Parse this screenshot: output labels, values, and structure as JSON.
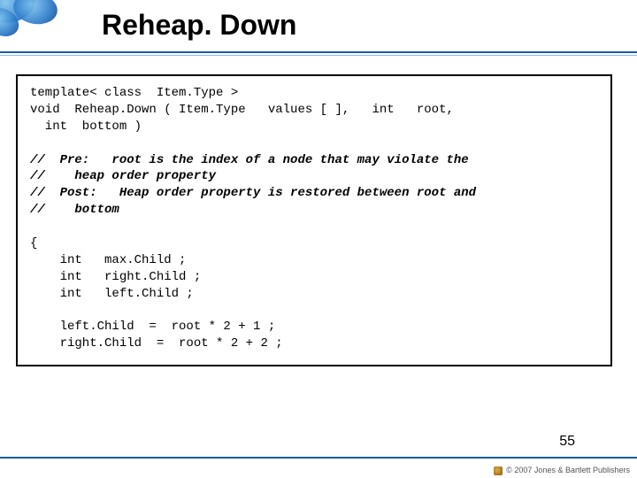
{
  "title": "Reheap. Down",
  "code": {
    "sig1": "template< class  Item.Type >",
    "sig2": "void  Reheap.Down ( Item.Type   values [ ],   int   root,",
    "sig3": "  int  bottom )",
    "cmt1": "//  Pre:   root is the index of a node that may violate the",
    "cmt2": "//    heap order property",
    "cmt3": "//  Post:   Heap order property is restored between root and",
    "cmt4": "//    bottom",
    "brace": "{",
    "decl1": "    int   max.Child ;",
    "decl2": "    int   right.Child ;",
    "decl3": "    int   left.Child ;",
    "asg1": "    left.Child  =  root * 2 + 1 ;",
    "asg2": "    right.Child  =  root * 2 + 2 ;"
  },
  "page_number": "55",
  "footer": "© 2007 Jones & Bartlett Publishers"
}
